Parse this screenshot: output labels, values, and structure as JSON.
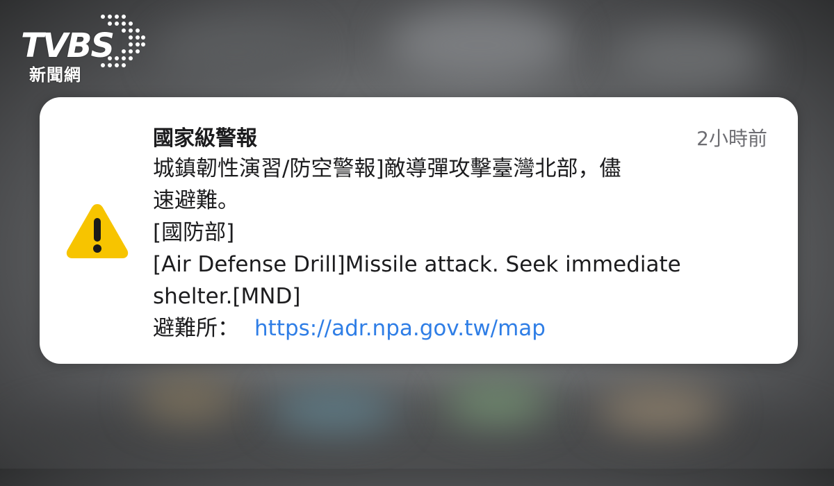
{
  "watermark": {
    "brand": "TVBS",
    "subtitle": "新聞網"
  },
  "notification": {
    "title": "國家級警報",
    "time": "2小時前",
    "icon": "warning-triangle-icon",
    "lines": [
      "城鎮韌性演習/防空警報]敵導彈攻擊臺灣北部，儘",
      "速避難。",
      "[國防部]",
      "[Air Defense Drill]Missile attack. Seek immediate",
      "shelter.[MND]"
    ],
    "shelter_label": "避難所：",
    "shelter_link": "https://adr.npa.gov.tw/map"
  },
  "colors": {
    "warning": "#F7C400",
    "link": "#2F7EE6",
    "card_bg": "#FFFFFF"
  }
}
